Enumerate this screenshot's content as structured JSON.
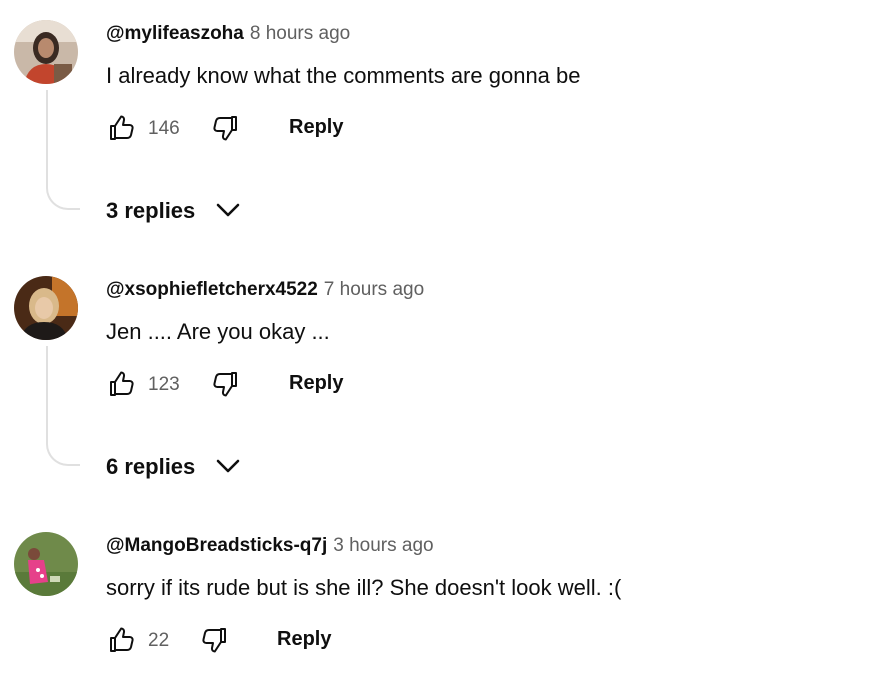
{
  "comments": [
    {
      "handle": "@mylifeaszoha",
      "time": "8 hours ago",
      "text": "I already know what the comments are gonna be",
      "likes": "146",
      "reply_label": "Reply",
      "replies_label": "3 replies"
    },
    {
      "handle": "@xsophiefletcherx4522",
      "time": "7 hours ago",
      "text": "Jen .... Are you okay ...",
      "likes": "123",
      "reply_label": "Reply",
      "replies_label": "6 replies"
    },
    {
      "handle": "@MangoBreadsticks-q7j",
      "time": "3 hours ago",
      "text": "sorry if its rude but is she ill? She doesn't look well. :(",
      "likes": "22",
      "reply_label": "Reply"
    }
  ],
  "icons": {
    "like": "thumbs-up-icon",
    "dislike": "thumbs-down-icon",
    "expand": "chevron-down-icon"
  },
  "colors": {
    "text": "#0f0f0f",
    "secondary": "#606060",
    "thread_line": "#e0e0e0"
  }
}
